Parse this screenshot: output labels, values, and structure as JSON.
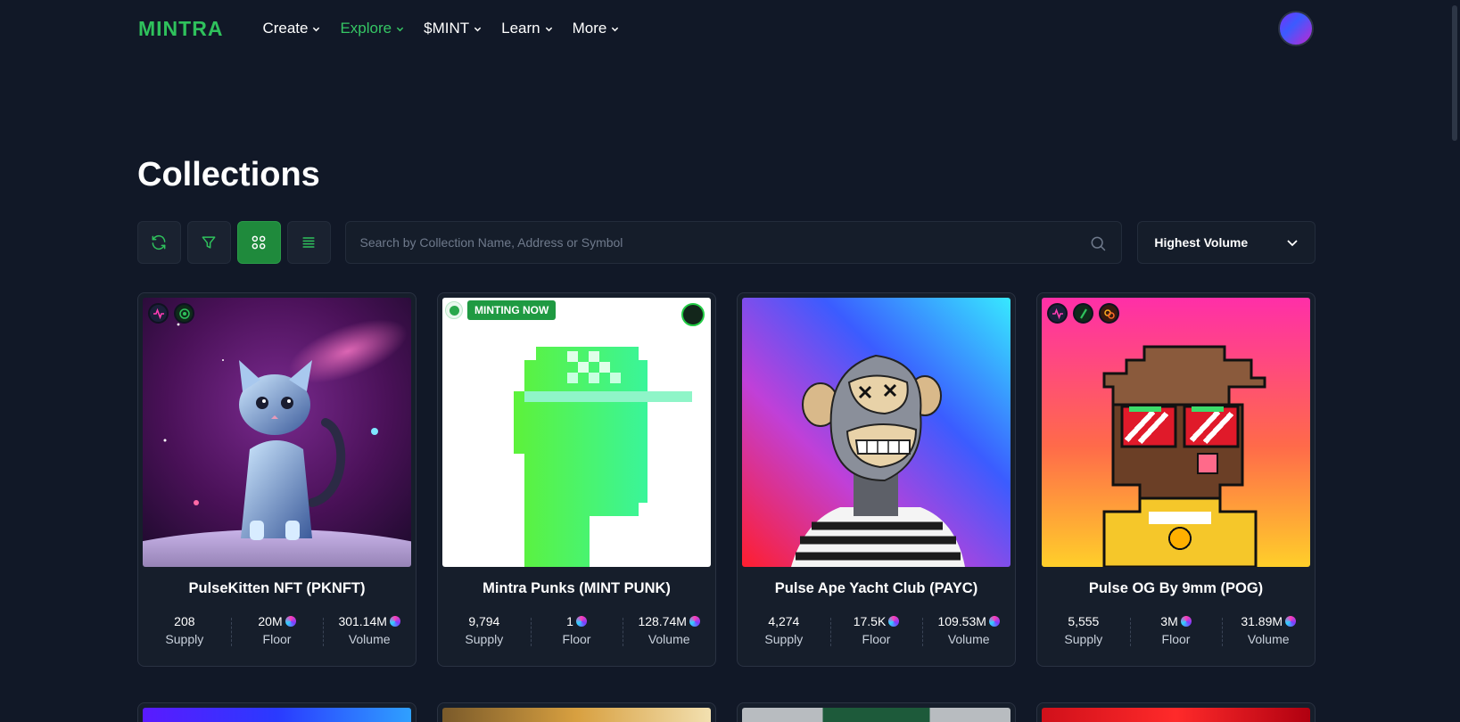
{
  "nav": {
    "logo": "MINTRA",
    "items": [
      {
        "label": "Create",
        "active": false
      },
      {
        "label": "Explore",
        "active": true
      },
      {
        "label": "$MINT",
        "active": false
      },
      {
        "label": "Learn",
        "active": false
      },
      {
        "label": "More",
        "active": false
      }
    ]
  },
  "page": {
    "title": "Collections"
  },
  "toolbar": {
    "search_placeholder": "Search by Collection Name, Address or Symbol",
    "sort_label": "Highest Volume"
  },
  "labels": {
    "supply": "Supply",
    "floor": "Floor",
    "volume": "Volume"
  },
  "minting_badge": "MINTING NOW",
  "cards": [
    {
      "name": "PulseKitten NFT  (PKNFT)",
      "supply": "208",
      "floor": "20M",
      "volume": "301.14M"
    },
    {
      "name": "Mintra Punks  (MINT PUNK)",
      "supply": "9,794",
      "floor": "1",
      "volume": "128.74M"
    },
    {
      "name": "Pulse Ape Yacht Club  (PAYC)",
      "supply": "4,274",
      "floor": "17.5K",
      "volume": "109.53M"
    },
    {
      "name": "Pulse OG By 9mm  (POG)",
      "supply": "5,555",
      "floor": "3M",
      "volume": "31.89M"
    }
  ],
  "colors": {
    "background": "#111827",
    "brand_green": "#2fc15c",
    "active_toggle": "#1f8a3c",
    "card_bg": "#161e2b"
  }
}
